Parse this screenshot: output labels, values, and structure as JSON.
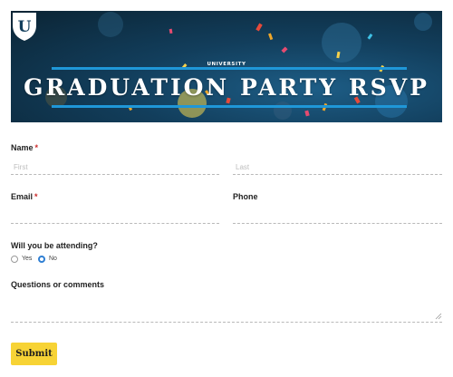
{
  "banner": {
    "title": "GRADUATION PARTY RSVP",
    "logo_letter": "U",
    "logo_word": "UNIVERSITY"
  },
  "form": {
    "name": {
      "label": "Name",
      "required": "*",
      "first_placeholder": "First",
      "last_placeholder": "Last"
    },
    "email": {
      "label": "Email",
      "required": "*"
    },
    "phone": {
      "label": "Phone"
    },
    "attending": {
      "label": "Will you be attending?",
      "options": [
        "Yes",
        "No"
      ],
      "selected": "No"
    },
    "comments": {
      "label": "Questions or comments"
    },
    "submit_label": "Submit"
  },
  "colors": {
    "submit_bg": "#f7d335",
    "radio_accent": "#2f7fd3",
    "required": "#cc2a2a",
    "stripe": "#1f97d8"
  }
}
